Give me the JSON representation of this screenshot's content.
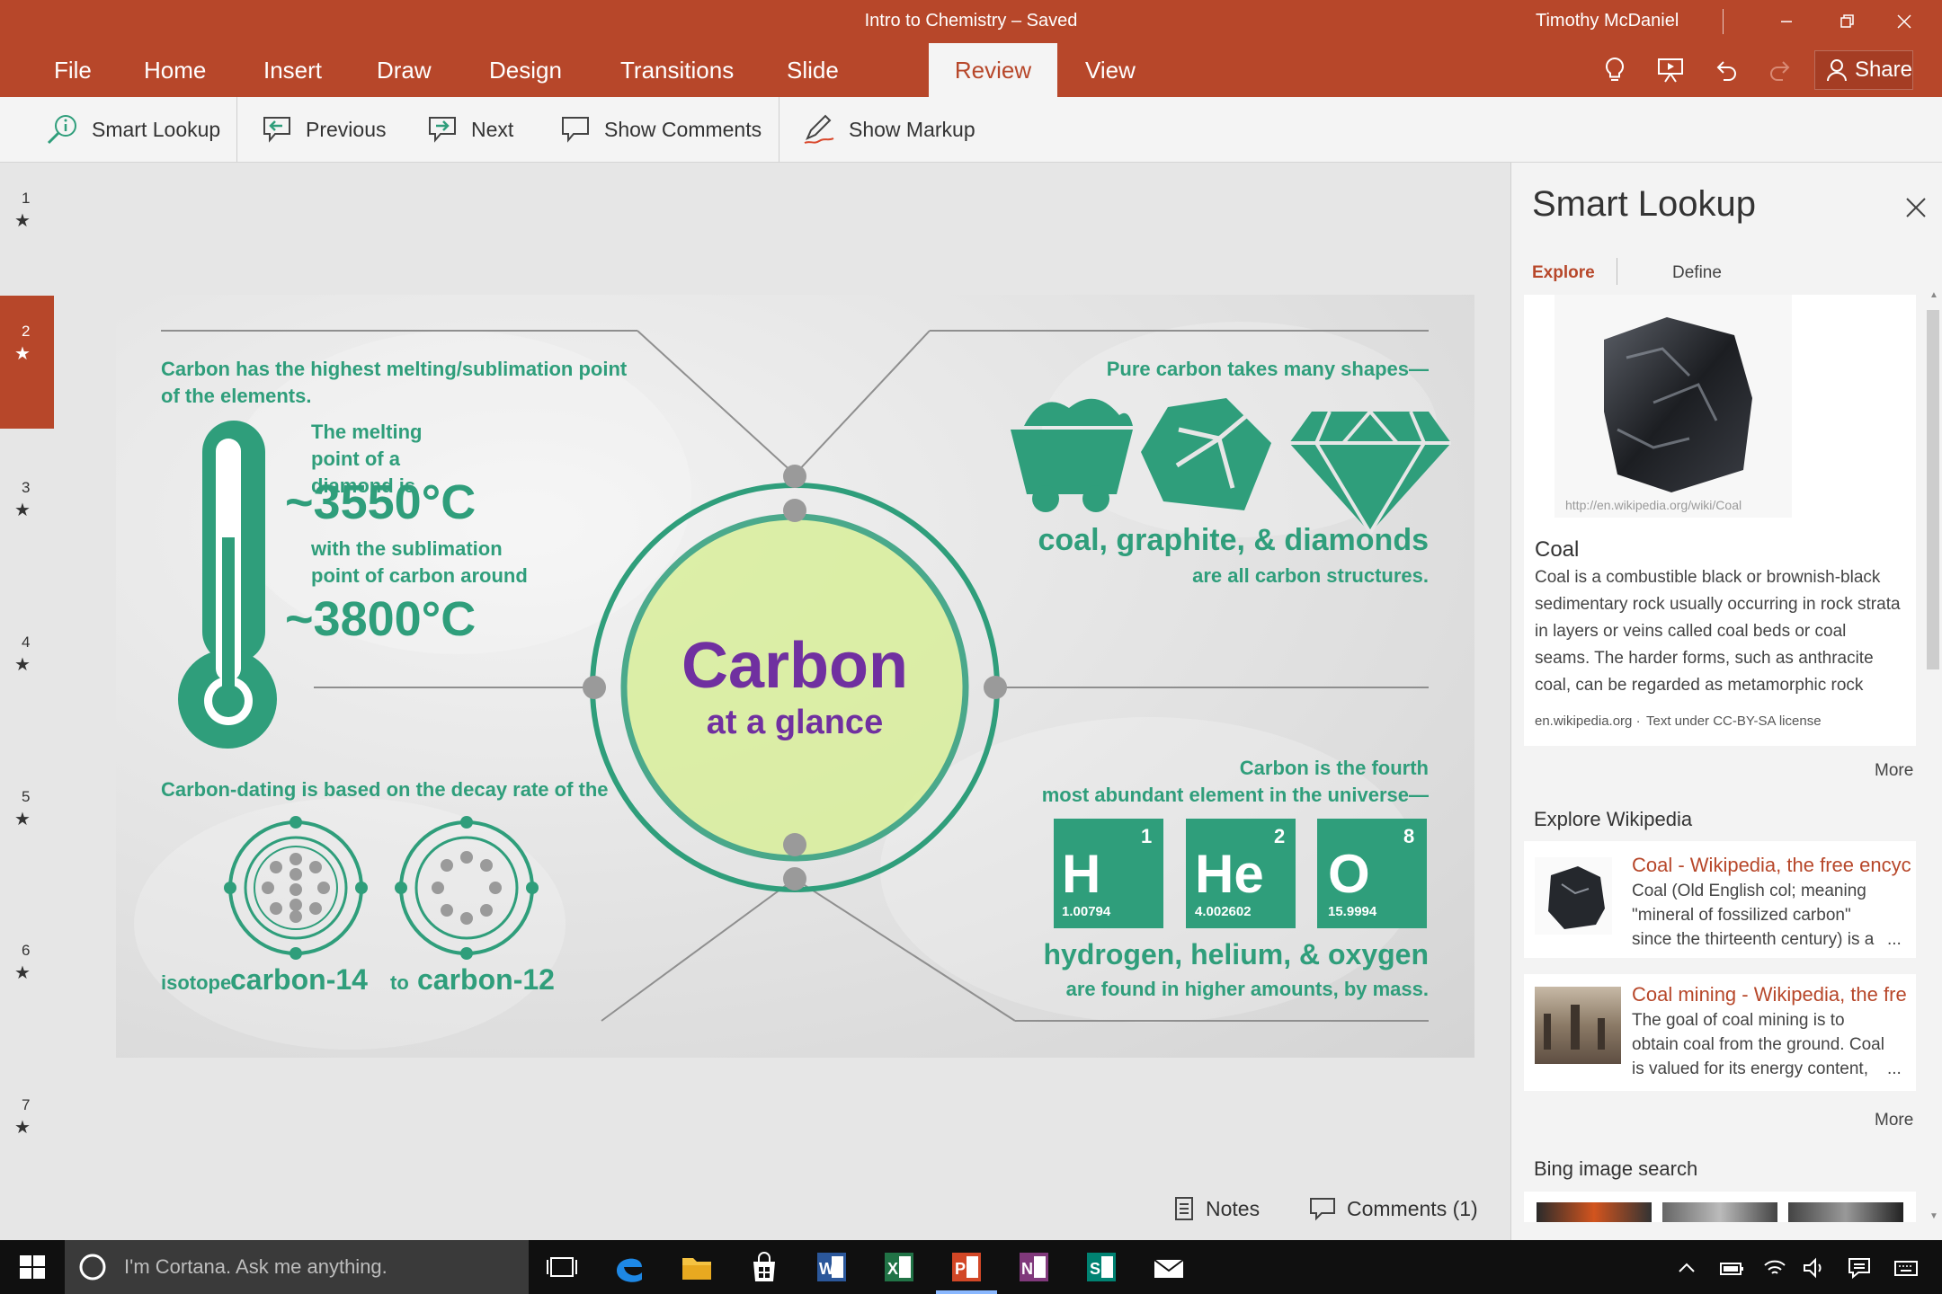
{
  "window": {
    "title": "Intro to Chemistry – Saved",
    "user": "Timothy McDaniel",
    "controls": [
      "minimize-icon",
      "restore-icon",
      "close-icon"
    ]
  },
  "tabs": [
    "File",
    "Home",
    "Insert",
    "Draw",
    "Design",
    "Transitions",
    "Slide Show",
    "Review",
    "View"
  ],
  "active_tab": "Review",
  "quick_access": {
    "icons": [
      "lightbulb-icon",
      "present-icon",
      "undo-icon",
      "redo-icon"
    ],
    "share_label": "Share"
  },
  "ribbon": {
    "smart_lookup": "Smart Lookup",
    "previous": "Previous",
    "next": "Next",
    "show_comments": "Show Comments",
    "show_markup": "Show Markup"
  },
  "slides": [
    {
      "number": "1",
      "marker": "★"
    },
    {
      "number": "2",
      "marker": "★"
    },
    {
      "number": "3",
      "marker": "★"
    },
    {
      "number": "4",
      "marker": "★"
    },
    {
      "number": "5",
      "marker": "★"
    },
    {
      "number": "6",
      "marker": "★"
    },
    {
      "number": "7",
      "marker": "★"
    }
  ],
  "active_slide": "2",
  "slide": {
    "center_title": "Carbon",
    "center_subtitle": "at a glance",
    "melting_heading": "Carbon has the highest melting/sublimation point of the elements.",
    "melting_intro": "The melting point of a diamond is",
    "melting_value": "~3550°C",
    "sublimation_intro": "with the sublimation point of carbon around",
    "sublimation_value": "~3800°C",
    "shapes_heading": "Pure carbon takes many shapes—",
    "shapes_list": "coal, graphite, & diamonds",
    "shapes_tail": "are all carbon structures.",
    "dating_heading": "Carbon-dating is based on the decay rate of the",
    "dating_isotope": "isotope",
    "dating_c14": "carbon-14",
    "dating_to": "to",
    "dating_c12": "carbon-12",
    "abundance_heading_1": "Carbon is the fourth",
    "abundance_heading_2": "most abundant element in the universe—",
    "elements": [
      {
        "symbol": "H",
        "number": "1",
        "mass": "1.00794"
      },
      {
        "symbol": "He",
        "number": "2",
        "mass": "4.002602"
      },
      {
        "symbol": "O",
        "number": "8",
        "mass": "15.9994"
      }
    ],
    "abundance_list": "hydrogen, helium, & oxygen",
    "abundance_tail": "are found in higher amounts, by mass.",
    "colors": {
      "green": "#2f9e7b",
      "purple": "#7030a0",
      "lime": "#d9ef9b"
    }
  },
  "status": {
    "notes": "Notes",
    "comments": "Comments (1)"
  },
  "pane": {
    "title": "Smart Lookup",
    "tabs": [
      "Explore",
      "Define"
    ],
    "active_tab": "Explore",
    "image_caption": "http://en.wikipedia.org/wiki/Coal",
    "result_title": "Coal",
    "result_text": "Coal is a combustible black or brownish-black sedimentary rock usually occurring in rock strata in layers or veins called coal beds or coal seams. The harder forms, such as anthracite coal, can be regarded as metamorphic rock because of late…",
    "result_source": "en.wikipedia.org ·",
    "result_license": "Text under CC-BY-SA license",
    "more_1": "More",
    "wiki_heading": "Explore Wikipedia",
    "wiki": [
      {
        "title": "Coal - Wikipedia, the free encyc",
        "snippet": "Coal (Old English col; meaning \"mineral of fossilized carbon\" since the thirteenth century) is a",
        "ellipsis": "..."
      },
      {
        "title": "Coal mining - Wikipedia, the fre",
        "snippet": "The goal of coal mining is to obtain coal from the ground. Coal is valued for its energy content, and, since",
        "ellipsis": "..."
      }
    ],
    "more_2": "More",
    "bing_heading": "Bing image search"
  },
  "taskbar": {
    "cortana_placeholder": "I'm Cortana. Ask me anything.",
    "apps": [
      "task-view-icon",
      "edge-icon",
      "file-explorer-icon",
      "store-icon",
      "word-icon",
      "excel-icon",
      "powerpoint-icon",
      "onenote-icon",
      "sway-icon",
      "mail-icon"
    ],
    "active_app": "powerpoint-icon"
  }
}
